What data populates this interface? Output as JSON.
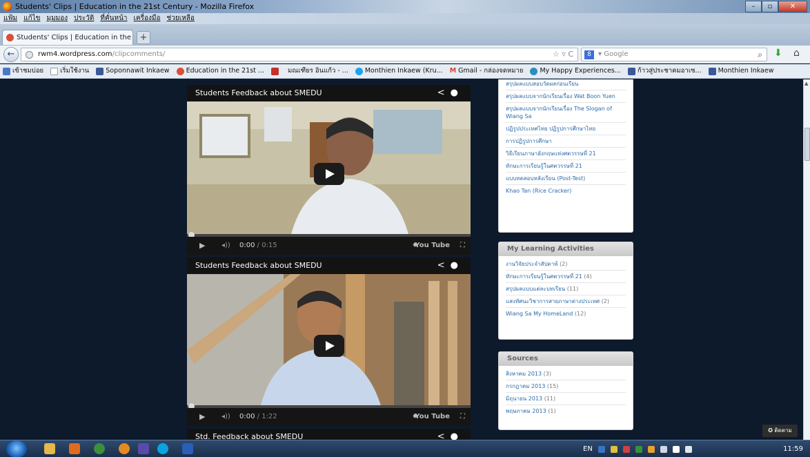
{
  "window": {
    "title": "Students' Clips | Education in the 21st Century - Mozilla Firefox"
  },
  "menu": [
    "แฟ้ม",
    "แก้ไข",
    "มุมมอง",
    "ประวัติ",
    "ที่คั่นหน้า",
    "เครื่องมือ",
    "ช่วยเหลือ"
  ],
  "tab": {
    "title": "Students' Clips | Education in the 21st Ce...",
    "new_tab": "+"
  },
  "nav": {
    "url_host": "rwm4.wordpress.com",
    "url_path": "/clipcomments/",
    "search_placeholder": "Google",
    "search_engine": "8"
  },
  "bookmarks": [
    {
      "label": "เข้าชมบ่อย",
      "color": "#4b79c7"
    },
    {
      "label": "เริ่มใช้งาน",
      "color": "#ffffff"
    },
    {
      "label": "Soponnawit Inkaew",
      "color": "#3b5998"
    },
    {
      "label": "Education in the 21st ...",
      "color": "#d94f3a"
    },
    {
      "label": "",
      "color": "#c4302b"
    },
    {
      "label": "มณเฑียร อินแก้ว - ...",
      "color": "#ffffff"
    },
    {
      "label": "Monthien Inkaew (Kru...",
      "color": "#1da1f2"
    },
    {
      "label": "Gmail - กล่องจดหมาย",
      "color": "#d14836"
    },
    {
      "label": "My Happy Experiences...",
      "color": "#2a8fbd"
    },
    {
      "label": "ก้าวสู่ประชาคมอาเซ...",
      "color": "#3b5998"
    },
    {
      "label": "Monthien Inkaew",
      "color": "#3b5998"
    }
  ],
  "videos": [
    {
      "title": "Students Feedback about SMEDU",
      "current": "0:00",
      "duration": "/ 0:15"
    },
    {
      "title": "Students Feedback about SMEDU",
      "current": "0:00",
      "duration": "/ 1:22"
    },
    {
      "title": "Std. Feedback about SMEDU"
    }
  ],
  "sidebar": {
    "recent_posts": [
      "สรุปผลแบบสอบวัดผลก่อนเรียน",
      "สรุปผลแบบจากนักเรียนเรื่อง Wat Boon Yuen",
      "สรุปผลแบบจากนักเรียนเรื่อง The Slogan of Wiang Sa",
      "ปฏิรูปประเทศไทย ปฏิรูปการศึกษาไทย",
      "การปฏิรูปการศึกษา",
      "วิธีเรียนภาษาอังกฤษแห่งศตวรรษที่ 21",
      "ทักษะการเรียนรู้ในศตวรรษที่ 21",
      "แบบทดสอบหลังเรียน (Post-Test)",
      "Khao Tan (Rice Cracker)"
    ],
    "learning": {
      "title": "My Learning Activities",
      "items": [
        {
          "label": "งานวิจัยประจำสัปดาห์",
          "count": "(2)"
        },
        {
          "label": "ทักษะการเรียนรู้ในศตวรรษที่ 21",
          "count": "(4)"
        },
        {
          "label": "สรุปผลแบบแต่ละบทเรียน",
          "count": "(11)"
        },
        {
          "label": "แสงทัศนะวิชาการสายภาษาต่างประเทศ",
          "count": "(2)"
        },
        {
          "label": "Wiang Sa My HomeLand",
          "count": "(12)"
        }
      ]
    },
    "sources": {
      "title": "Sources",
      "items": [
        {
          "label": "สิงหาคม 2013",
          "count": "(3)"
        },
        {
          "label": "กรกฎาคม 2013",
          "count": "(15)"
        },
        {
          "label": "มิถุนายน 2013",
          "count": "(11)"
        },
        {
          "label": "พฤษภาคม 2013",
          "count": "(1)"
        }
      ]
    }
  },
  "follow_button": "✪ ติดตาม",
  "taskbar": {
    "lang": "EN",
    "time": "11:59"
  }
}
